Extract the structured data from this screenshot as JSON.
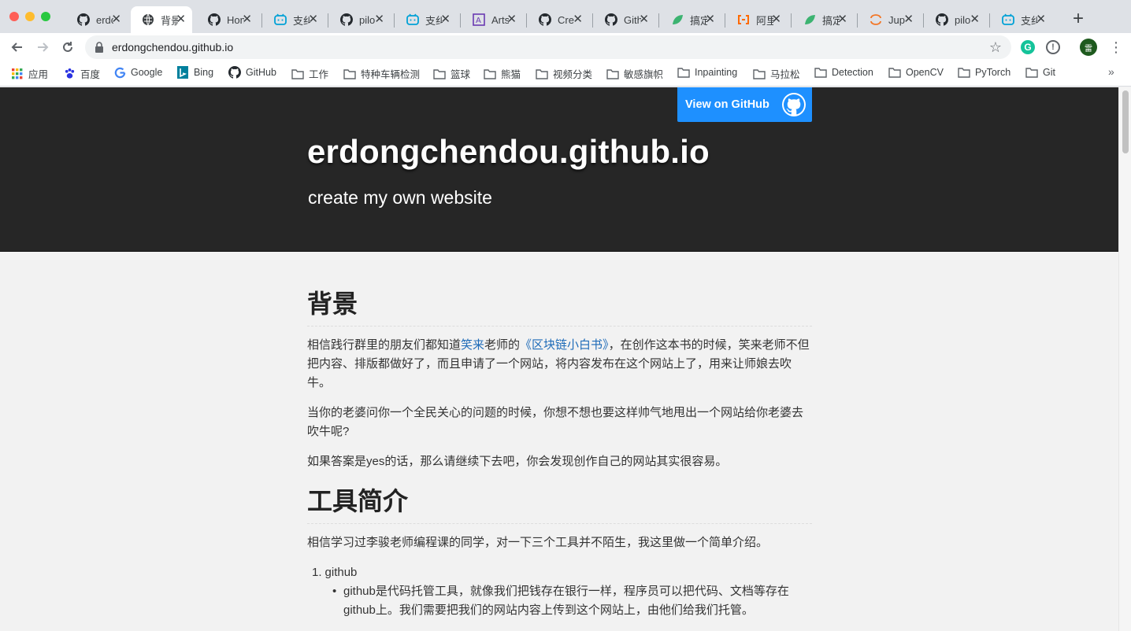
{
  "browser": {
    "tabs": [
      {
        "title": "erdo",
        "icon": "github-icon",
        "active": false
      },
      {
        "title": "背景",
        "icon": "globe-icon",
        "active": true
      },
      {
        "title": "Hon",
        "icon": "github-icon",
        "active": false
      },
      {
        "title": "支纠",
        "icon": "bilibili-icon",
        "active": false
      },
      {
        "title": "pilo",
        "icon": "github-icon",
        "active": false
      },
      {
        "title": "支纠",
        "icon": "bilibili-icon",
        "active": false
      },
      {
        "title": "Arts",
        "icon": "letter-a-icon",
        "active": false
      },
      {
        "title": "Cre",
        "icon": "github-icon",
        "active": false
      },
      {
        "title": "Gith",
        "icon": "github-icon",
        "active": false
      },
      {
        "title": "搞定",
        "icon": "leaf-icon",
        "active": false
      },
      {
        "title": "阿里",
        "icon": "aliyun-icon",
        "active": false
      },
      {
        "title": "搞定",
        "icon": "leaf-icon",
        "active": false
      },
      {
        "title": "Jup",
        "icon": "jupyter-icon",
        "active": false
      },
      {
        "title": "pilo",
        "icon": "github-icon",
        "active": false
      },
      {
        "title": "支纠",
        "icon": "bilibili-icon",
        "active": false
      }
    ],
    "url": "erdongchendou.github.io",
    "profile_initial": "雷",
    "bookmarks": [
      {
        "label": "应用",
        "icon": "apps-grid-icon"
      },
      {
        "label": "百度",
        "icon": "baidu-paw-icon"
      },
      {
        "label": "Google",
        "icon": "google-icon"
      },
      {
        "label": "Bing",
        "icon": "bing-icon"
      },
      {
        "label": "GitHub",
        "icon": "github-icon"
      },
      {
        "label": "工作",
        "icon": "folder-icon"
      },
      {
        "label": "特种车辆检测",
        "icon": "folder-icon"
      },
      {
        "label": "篮球",
        "icon": "folder-icon"
      },
      {
        "label": "熊猫",
        "icon": "folder-icon"
      },
      {
        "label": "视频分类",
        "icon": "folder-icon"
      },
      {
        "label": "敏感旗帜",
        "icon": "folder-icon"
      },
      {
        "label": "Inpainting",
        "icon": "folder-icon"
      },
      {
        "label": "马拉松",
        "icon": "folder-icon"
      },
      {
        "label": "Detection",
        "icon": "folder-icon"
      },
      {
        "label": "OpenCV",
        "icon": "folder-icon"
      },
      {
        "label": "PyTorch",
        "icon": "folder-icon"
      },
      {
        "label": "Git",
        "icon": "folder-icon"
      }
    ],
    "overflow_label": "»"
  },
  "site": {
    "github_button": "View on GitHub",
    "title": "erdongchendou.github.io",
    "subtitle": "create my own website",
    "sections": {
      "bg_heading": "背景",
      "p1_a": "相信践行群里的朋友们都知道",
      "p1_link1": "笑来",
      "p1_b": "老师的",
      "p1_link2": "《区块链小白书》",
      "p1_c": "，在创作这本书的时候，笑来老师不但把内容、排版都做好了，而且申请了一个网站，将内容发布在这个网站上了，用来让师娘去吹牛。",
      "p2": "当你的老婆问你一个全民关心的问题的时候，你想不想也要这样帅气地甩出一个网站给你老婆去吹牛呢?",
      "p3": "如果答案是yes的话，那么请继续下去吧，你会发现创作自己的网站其实很容易。",
      "tools_heading": "工具简介",
      "p4": "相信学习过李骏老师编程课的同学，对一下三个工具并不陌生，我这里做一个简单介绍。",
      "item1_num": "1.",
      "item1": "github",
      "item1_sub": "github是代码托管工具，就像我们把钱存在银行一样，程序员可以把代码、文档等存在github上。我们需要把我们的网站内容上传到这个网站上，由他们给我们托管。"
    }
  },
  "colors": {
    "header_bg": "#262626",
    "github_button": "#1e90ff",
    "link": "#1e6bb8",
    "page_bg": "#f2f2f2"
  }
}
